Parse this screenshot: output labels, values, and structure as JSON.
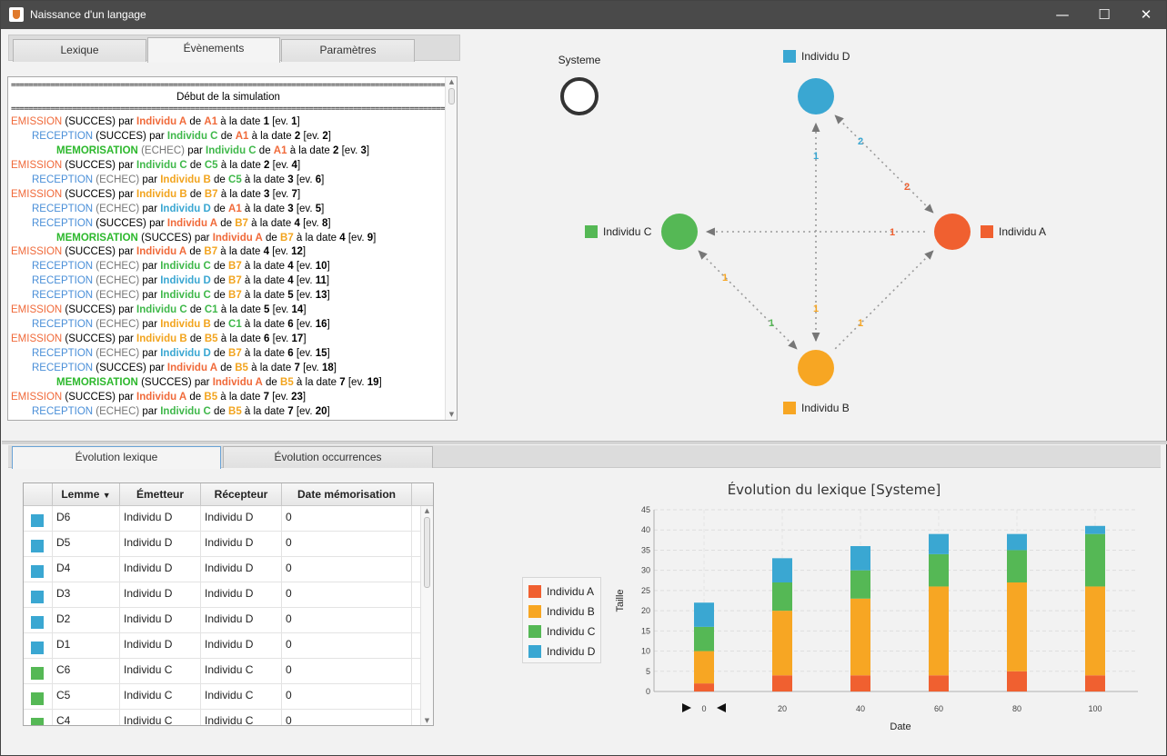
{
  "window": {
    "title": "Naissance d'un langage",
    "minimize": "—",
    "maximize": "☐",
    "close": "✕"
  },
  "top_tabs": [
    "Lexique",
    "Évènements",
    "Paramètres"
  ],
  "log": {
    "separator": "==========================================================================================================",
    "start_text": "Début de la simulation",
    "rows": [
      {
        "indent": 0,
        "kind": "EMISSION",
        "status": "(SUCCES)",
        "who": "Individu A",
        "whoc": "A",
        "word": "A1",
        "date": "1",
        "ev": "1"
      },
      {
        "indent": 1,
        "kind": "RECEPTION",
        "status": "(SUCCES)",
        "who": "Individu C",
        "whoc": "C",
        "word": "A1",
        "date": "2",
        "ev": "2"
      },
      {
        "indent": 2,
        "kind": "MEMORISATION",
        "status": "(ECHEC)",
        "who": "Individu C",
        "whoc": "C",
        "word": "A1",
        "date": "2",
        "ev": "3"
      },
      {
        "indent": 0,
        "kind": "EMISSION",
        "status": "(SUCCES)",
        "who": "Individu C",
        "whoc": "C",
        "word": "C5",
        "date": "2",
        "ev": "4"
      },
      {
        "indent": 1,
        "kind": "RECEPTION",
        "status": "(ECHEC)",
        "who": "Individu B",
        "whoc": "B",
        "word": "C5",
        "date": "3",
        "ev": "6"
      },
      {
        "indent": 0,
        "kind": "EMISSION",
        "status": "(SUCCES)",
        "who": "Individu B",
        "whoc": "B",
        "word": "B7",
        "date": "3",
        "ev": "7"
      },
      {
        "indent": 1,
        "kind": "RECEPTION",
        "status": "(ECHEC)",
        "who": "Individu D",
        "whoc": "D",
        "word": "A1",
        "date": "3",
        "ev": "5"
      },
      {
        "indent": 1,
        "kind": "RECEPTION",
        "status": "(SUCCES)",
        "who": "Individu A",
        "whoc": "A",
        "word": "B7",
        "date": "4",
        "ev": "8"
      },
      {
        "indent": 2,
        "kind": "MEMORISATION",
        "status": "(SUCCES)",
        "who": "Individu A",
        "whoc": "A",
        "word": "B7",
        "date": "4",
        "ev": "9"
      },
      {
        "indent": 0,
        "kind": "EMISSION",
        "status": "(SUCCES)",
        "who": "Individu A",
        "whoc": "A",
        "word": "B7",
        "date": "4",
        "ev": "12"
      },
      {
        "indent": 1,
        "kind": "RECEPTION",
        "status": "(ECHEC)",
        "who": "Individu C",
        "whoc": "C",
        "word": "B7",
        "date": "4",
        "ev": "10"
      },
      {
        "indent": 1,
        "kind": "RECEPTION",
        "status": "(ECHEC)",
        "who": "Individu D",
        "whoc": "D",
        "word": "B7",
        "date": "4",
        "ev": "11"
      },
      {
        "indent": 1,
        "kind": "RECEPTION",
        "status": "(ECHEC)",
        "who": "Individu C",
        "whoc": "C",
        "word": "B7",
        "date": "5",
        "ev": "13"
      },
      {
        "indent": 0,
        "kind": "EMISSION",
        "status": "(SUCCES)",
        "who": "Individu C",
        "whoc": "C",
        "word": "C1",
        "date": "5",
        "ev": "14"
      },
      {
        "indent": 1,
        "kind": "RECEPTION",
        "status": "(ECHEC)",
        "who": "Individu B",
        "whoc": "B",
        "word": "C1",
        "date": "6",
        "ev": "16"
      },
      {
        "indent": 0,
        "kind": "EMISSION",
        "status": "(SUCCES)",
        "who": "Individu B",
        "whoc": "B",
        "word": "B5",
        "date": "6",
        "ev": "17"
      },
      {
        "indent": 1,
        "kind": "RECEPTION",
        "status": "(ECHEC)",
        "who": "Individu D",
        "whoc": "D",
        "word": "B7",
        "date": "6",
        "ev": "15"
      },
      {
        "indent": 1,
        "kind": "RECEPTION",
        "status": "(SUCCES)",
        "who": "Individu A",
        "whoc": "A",
        "word": "B5",
        "date": "7",
        "ev": "18"
      },
      {
        "indent": 2,
        "kind": "MEMORISATION",
        "status": "(SUCCES)",
        "who": "Individu A",
        "whoc": "A",
        "word": "B5",
        "date": "7",
        "ev": "19"
      },
      {
        "indent": 0,
        "kind": "EMISSION",
        "status": "(SUCCES)",
        "who": "Individu A",
        "whoc": "A",
        "word": "B5",
        "date": "7",
        "ev": "23"
      },
      {
        "indent": 1,
        "kind": "RECEPTION",
        "status": "(ECHEC)",
        "who": "Individu C",
        "whoc": "C",
        "word": "B5",
        "date": "7",
        "ev": "20"
      }
    ],
    "words": {
      "par": "par",
      "de": "de",
      "a_la_date": "à la date",
      "ev": "ev."
    }
  },
  "graph": {
    "systeme_label": "Systeme",
    "nodes": [
      {
        "name": "Individu D",
        "color": "#3aa7d2"
      },
      {
        "name": "Individu A",
        "color": "#f06030"
      },
      {
        "name": "Individu C",
        "color": "#55b855"
      },
      {
        "name": "Individu B",
        "color": "#f7a623"
      }
    ],
    "edges": [
      {
        "from": "Individu B",
        "to": "Individu D",
        "label": "1",
        "color": "#3aa7d2"
      },
      {
        "from": "Individu D",
        "to": "Individu B",
        "label": "1",
        "color": "#f7a623"
      },
      {
        "from": "Individu D",
        "to": "Individu A",
        "label": "2",
        "color": "#3aa7d2"
      },
      {
        "from": "Individu A",
        "to": "Individu D",
        "label": "2",
        "color": "#f06030"
      },
      {
        "from": "Individu A",
        "to": "Individu C",
        "label": "1",
        "color": "#f06030"
      },
      {
        "from": "Individu C",
        "to": "Individu B",
        "label": "1",
        "color": "#55b855"
      },
      {
        "from": "Individu B",
        "to": "Individu C",
        "label": "1",
        "color": "#f7a623"
      },
      {
        "from": "Individu B",
        "to": "Individu A",
        "label": "1",
        "color": "#f7a623"
      }
    ]
  },
  "bottom_tabs": [
    "Évolution lexique",
    "Évolution occurrences"
  ],
  "table": {
    "headers": [
      "Lemme",
      "Émetteur",
      "Récepteur",
      "Date mémorisation"
    ],
    "sort_icon": "▼",
    "rows": [
      {
        "color": "#3aa7d2",
        "lemme": "D6",
        "emetteur": "Individu D",
        "recepteur": "Individu D",
        "date": "0"
      },
      {
        "color": "#3aa7d2",
        "lemme": "D5",
        "emetteur": "Individu D",
        "recepteur": "Individu D",
        "date": "0"
      },
      {
        "color": "#3aa7d2",
        "lemme": "D4",
        "emetteur": "Individu D",
        "recepteur": "Individu D",
        "date": "0"
      },
      {
        "color": "#3aa7d2",
        "lemme": "D3",
        "emetteur": "Individu D",
        "recepteur": "Individu D",
        "date": "0"
      },
      {
        "color": "#3aa7d2",
        "lemme": "D2",
        "emetteur": "Individu D",
        "recepteur": "Individu D",
        "date": "0"
      },
      {
        "color": "#3aa7d2",
        "lemme": "D1",
        "emetteur": "Individu D",
        "recepteur": "Individu D",
        "date": "0"
      },
      {
        "color": "#55b855",
        "lemme": "C6",
        "emetteur": "Individu C",
        "recepteur": "Individu C",
        "date": "0"
      },
      {
        "color": "#55b855",
        "lemme": "C5",
        "emetteur": "Individu C",
        "recepteur": "Individu C",
        "date": "0"
      },
      {
        "color": "#55b855",
        "lemme": "C4",
        "emetteur": "Individu C",
        "recepteur": "Individu C",
        "date": "0"
      }
    ]
  },
  "chart_data": {
    "type": "bar",
    "title": "Évolution du lexique [Systeme]",
    "xlabel": "Date",
    "ylabel": "Taille",
    "ylim": [
      0,
      45
    ],
    "yticks": [
      0,
      5,
      10,
      15,
      20,
      25,
      30,
      35,
      40,
      45
    ],
    "categories": [
      "0",
      "20",
      "40",
      "60",
      "80",
      "100"
    ],
    "stacked": true,
    "grid": true,
    "legend_position": "left",
    "series": [
      {
        "name": "Individu A",
        "color": "#f06030",
        "values": [
          2,
          4,
          4,
          4,
          5,
          4
        ]
      },
      {
        "name": "Individu B",
        "color": "#f7a623",
        "values": [
          8,
          16,
          19,
          22,
          22,
          22
        ]
      },
      {
        "name": "Individu C",
        "color": "#55b855",
        "values": [
          6,
          7,
          7,
          8,
          8,
          13
        ]
      },
      {
        "name": "Individu D",
        "color": "#3aa7d2",
        "values": [
          6,
          6,
          6,
          5,
          4,
          2
        ]
      }
    ]
  }
}
